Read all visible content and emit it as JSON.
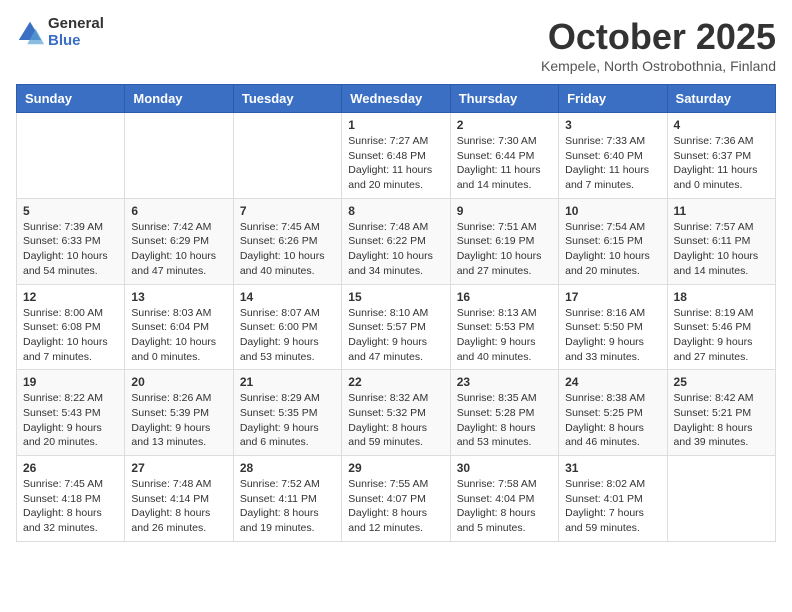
{
  "header": {
    "logo_general": "General",
    "logo_blue": "Blue",
    "month": "October 2025",
    "location": "Kempele, North Ostrobothnia, Finland"
  },
  "days_of_week": [
    "Sunday",
    "Monday",
    "Tuesday",
    "Wednesday",
    "Thursday",
    "Friday",
    "Saturday"
  ],
  "weeks": [
    [
      {
        "num": "",
        "info": ""
      },
      {
        "num": "",
        "info": ""
      },
      {
        "num": "",
        "info": ""
      },
      {
        "num": "1",
        "info": "Sunrise: 7:27 AM\nSunset: 6:48 PM\nDaylight: 11 hours\nand 20 minutes."
      },
      {
        "num": "2",
        "info": "Sunrise: 7:30 AM\nSunset: 6:44 PM\nDaylight: 11 hours\nand 14 minutes."
      },
      {
        "num": "3",
        "info": "Sunrise: 7:33 AM\nSunset: 6:40 PM\nDaylight: 11 hours\nand 7 minutes."
      },
      {
        "num": "4",
        "info": "Sunrise: 7:36 AM\nSunset: 6:37 PM\nDaylight: 11 hours\nand 0 minutes."
      }
    ],
    [
      {
        "num": "5",
        "info": "Sunrise: 7:39 AM\nSunset: 6:33 PM\nDaylight: 10 hours\nand 54 minutes."
      },
      {
        "num": "6",
        "info": "Sunrise: 7:42 AM\nSunset: 6:29 PM\nDaylight: 10 hours\nand 47 minutes."
      },
      {
        "num": "7",
        "info": "Sunrise: 7:45 AM\nSunset: 6:26 PM\nDaylight: 10 hours\nand 40 minutes."
      },
      {
        "num": "8",
        "info": "Sunrise: 7:48 AM\nSunset: 6:22 PM\nDaylight: 10 hours\nand 34 minutes."
      },
      {
        "num": "9",
        "info": "Sunrise: 7:51 AM\nSunset: 6:19 PM\nDaylight: 10 hours\nand 27 minutes."
      },
      {
        "num": "10",
        "info": "Sunrise: 7:54 AM\nSunset: 6:15 PM\nDaylight: 10 hours\nand 20 minutes."
      },
      {
        "num": "11",
        "info": "Sunrise: 7:57 AM\nSunset: 6:11 PM\nDaylight: 10 hours\nand 14 minutes."
      }
    ],
    [
      {
        "num": "12",
        "info": "Sunrise: 8:00 AM\nSunset: 6:08 PM\nDaylight: 10 hours\nand 7 minutes."
      },
      {
        "num": "13",
        "info": "Sunrise: 8:03 AM\nSunset: 6:04 PM\nDaylight: 10 hours\nand 0 minutes."
      },
      {
        "num": "14",
        "info": "Sunrise: 8:07 AM\nSunset: 6:00 PM\nDaylight: 9 hours\nand 53 minutes."
      },
      {
        "num": "15",
        "info": "Sunrise: 8:10 AM\nSunset: 5:57 PM\nDaylight: 9 hours\nand 47 minutes."
      },
      {
        "num": "16",
        "info": "Sunrise: 8:13 AM\nSunset: 5:53 PM\nDaylight: 9 hours\nand 40 minutes."
      },
      {
        "num": "17",
        "info": "Sunrise: 8:16 AM\nSunset: 5:50 PM\nDaylight: 9 hours\nand 33 minutes."
      },
      {
        "num": "18",
        "info": "Sunrise: 8:19 AM\nSunset: 5:46 PM\nDaylight: 9 hours\nand 27 minutes."
      }
    ],
    [
      {
        "num": "19",
        "info": "Sunrise: 8:22 AM\nSunset: 5:43 PM\nDaylight: 9 hours\nand 20 minutes."
      },
      {
        "num": "20",
        "info": "Sunrise: 8:26 AM\nSunset: 5:39 PM\nDaylight: 9 hours\nand 13 minutes."
      },
      {
        "num": "21",
        "info": "Sunrise: 8:29 AM\nSunset: 5:35 PM\nDaylight: 9 hours\nand 6 minutes."
      },
      {
        "num": "22",
        "info": "Sunrise: 8:32 AM\nSunset: 5:32 PM\nDaylight: 8 hours\nand 59 minutes."
      },
      {
        "num": "23",
        "info": "Sunrise: 8:35 AM\nSunset: 5:28 PM\nDaylight: 8 hours\nand 53 minutes."
      },
      {
        "num": "24",
        "info": "Sunrise: 8:38 AM\nSunset: 5:25 PM\nDaylight: 8 hours\nand 46 minutes."
      },
      {
        "num": "25",
        "info": "Sunrise: 8:42 AM\nSunset: 5:21 PM\nDaylight: 8 hours\nand 39 minutes."
      }
    ],
    [
      {
        "num": "26",
        "info": "Sunrise: 7:45 AM\nSunset: 4:18 PM\nDaylight: 8 hours\nand 32 minutes."
      },
      {
        "num": "27",
        "info": "Sunrise: 7:48 AM\nSunset: 4:14 PM\nDaylight: 8 hours\nand 26 minutes."
      },
      {
        "num": "28",
        "info": "Sunrise: 7:52 AM\nSunset: 4:11 PM\nDaylight: 8 hours\nand 19 minutes."
      },
      {
        "num": "29",
        "info": "Sunrise: 7:55 AM\nSunset: 4:07 PM\nDaylight: 8 hours\nand 12 minutes."
      },
      {
        "num": "30",
        "info": "Sunrise: 7:58 AM\nSunset: 4:04 PM\nDaylight: 8 hours\nand 5 minutes."
      },
      {
        "num": "31",
        "info": "Sunrise: 8:02 AM\nSunset: 4:01 PM\nDaylight: 7 hours\nand 59 minutes."
      },
      {
        "num": "",
        "info": ""
      }
    ]
  ]
}
